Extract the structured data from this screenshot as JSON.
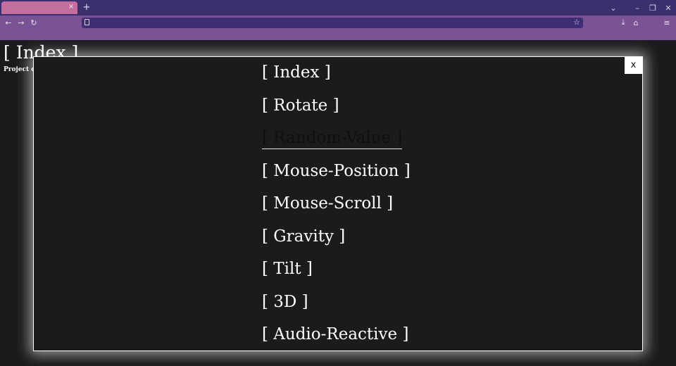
{
  "browser": {
    "tab": {
      "title": "",
      "close_glyph": "×"
    },
    "new_tab_glyph": "+",
    "window_controls": {
      "list_tabs_glyph": "⌄",
      "minimize_glyph": "–",
      "restore_glyph": "❐",
      "close_glyph": "✕"
    },
    "nav": {
      "back_glyph": "←",
      "forward_glyph": "→",
      "reload_glyph": "↻"
    },
    "url": "",
    "star_glyph": "☆",
    "download_glyph": "⤓",
    "extensions_glyph": "⌂",
    "menu_glyph": "≡",
    "colors": {
      "tabbar": "#3b2f6e",
      "active_tab": "#c46e9e",
      "toolbar": "#7a5394",
      "urlbar": "#3d2e73"
    }
  },
  "page": {
    "title": "[ Index ]",
    "subtitle": "Project concept - \"Process Book\", coach - James.",
    "background": "#1a1a1a"
  },
  "modal": {
    "close_label": "x",
    "active_item": "[ Random-Value ]",
    "items": [
      {
        "label": "[ Index ]"
      },
      {
        "label": "[ Rotate ]"
      },
      {
        "label": "[ Random-Value ]"
      },
      {
        "label": "[ Mouse-Position ]"
      },
      {
        "label": "[ Mouse-Scroll ]"
      },
      {
        "label": "[ Gravity ]"
      },
      {
        "label": "[ Tilt ]"
      },
      {
        "label": "[ 3D ]"
      },
      {
        "label": "[ Audio-Reactive ]"
      }
    ]
  }
}
